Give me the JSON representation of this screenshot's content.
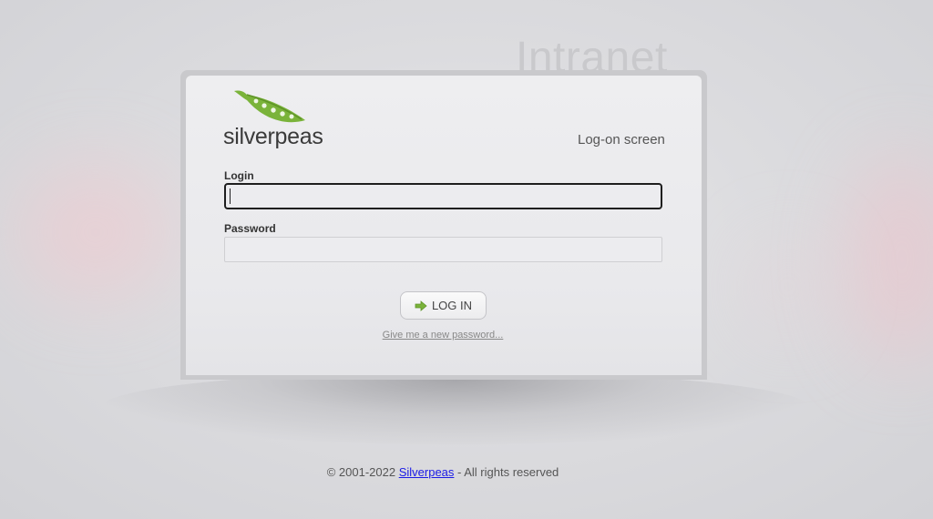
{
  "header": {
    "title": "Intranet"
  },
  "brand": {
    "name": "silverpeas",
    "logo_icon": "green-pea-pod-icon",
    "accent_color": "#7ab33a"
  },
  "login_panel": {
    "screen_title": "Log-on screen",
    "login_label": "Login",
    "login_value": "",
    "password_label": "Password",
    "password_value": "",
    "submit_label": "LOG IN",
    "submit_icon": "green-arrow-right-icon",
    "forgot_link": "Give me a new password..."
  },
  "footer": {
    "prefix": "© 2001-2022 ",
    "link_text": "Silverpeas",
    "suffix": " - All rights reserved",
    "link_color": "#1a1ae6"
  }
}
